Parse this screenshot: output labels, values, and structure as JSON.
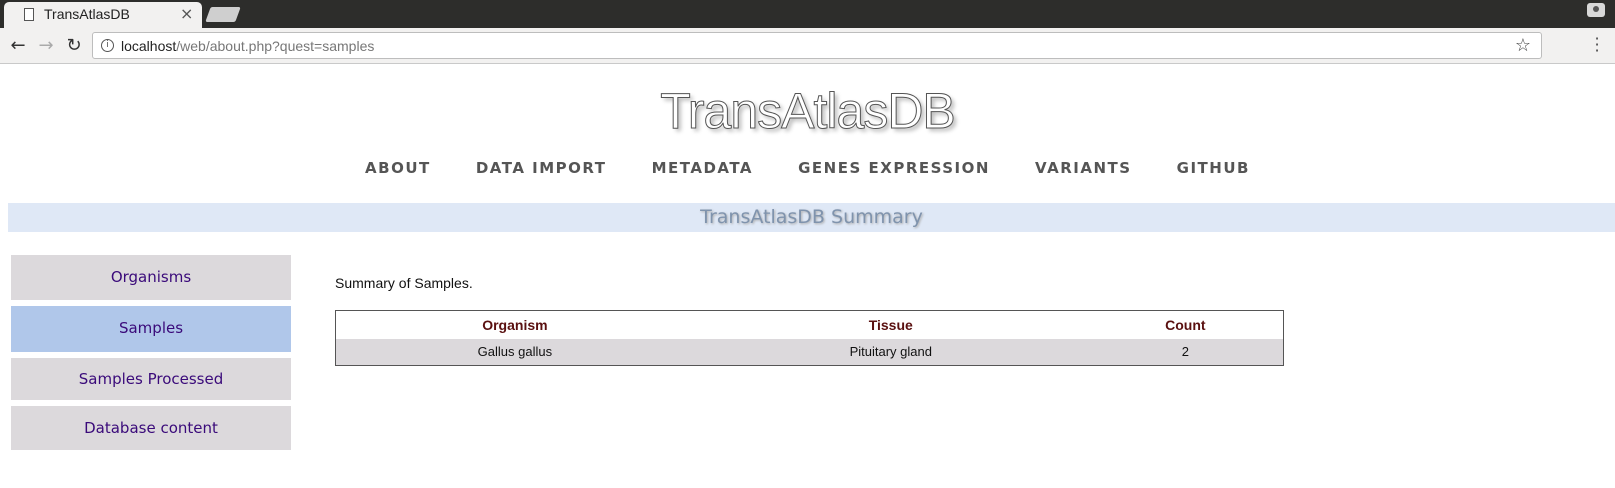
{
  "browser": {
    "tab_title": "TransAtlasDB",
    "tab_close": "×",
    "url_host": "localhost",
    "url_path": "/web/about.php?quest=samples"
  },
  "site": {
    "title": "TransAtlasDB",
    "nav": [
      "ABOUT",
      "DATA IMPORT",
      "METADATA",
      "GENES EXPRESSION",
      "VARIANTS",
      "GITHUB"
    ],
    "summary_heading": "TransAtlasDB Summary"
  },
  "sidebar": {
    "items": [
      "Organisms",
      "Samples",
      "Samples Processed",
      "Database content"
    ],
    "active": "Samples",
    "active_color": "#b0c7ea"
  },
  "content": {
    "intro": "Summary of Samples.",
    "table": {
      "headers": [
        "Organism",
        "Tissue",
        "Count"
      ],
      "rows": [
        [
          "Gallus gallus",
          "Pituitary gland",
          "2"
        ]
      ]
    }
  }
}
